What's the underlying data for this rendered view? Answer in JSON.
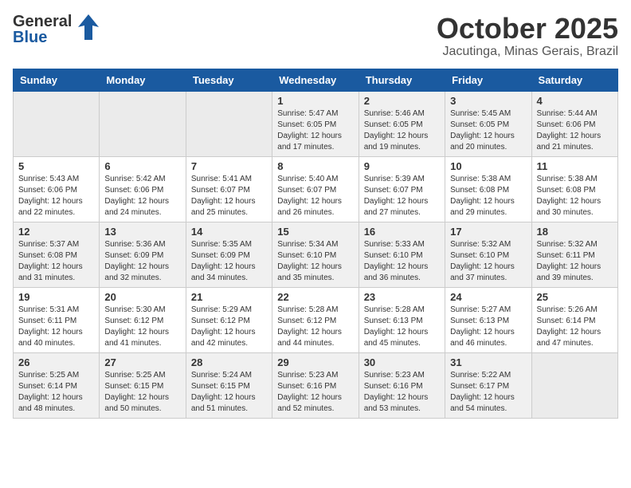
{
  "header": {
    "logo_general": "General",
    "logo_blue": "Blue",
    "month": "October 2025",
    "location": "Jacutinga, Minas Gerais, Brazil"
  },
  "weekdays": [
    "Sunday",
    "Monday",
    "Tuesday",
    "Wednesday",
    "Thursday",
    "Friday",
    "Saturday"
  ],
  "weeks": [
    [
      {
        "day": "",
        "info": ""
      },
      {
        "day": "",
        "info": ""
      },
      {
        "day": "",
        "info": ""
      },
      {
        "day": "1",
        "info": "Sunrise: 5:47 AM\nSunset: 6:05 PM\nDaylight: 12 hours\nand 17 minutes."
      },
      {
        "day": "2",
        "info": "Sunrise: 5:46 AM\nSunset: 6:05 PM\nDaylight: 12 hours\nand 19 minutes."
      },
      {
        "day": "3",
        "info": "Sunrise: 5:45 AM\nSunset: 6:05 PM\nDaylight: 12 hours\nand 20 minutes."
      },
      {
        "day": "4",
        "info": "Sunrise: 5:44 AM\nSunset: 6:06 PM\nDaylight: 12 hours\nand 21 minutes."
      }
    ],
    [
      {
        "day": "5",
        "info": "Sunrise: 5:43 AM\nSunset: 6:06 PM\nDaylight: 12 hours\nand 22 minutes."
      },
      {
        "day": "6",
        "info": "Sunrise: 5:42 AM\nSunset: 6:06 PM\nDaylight: 12 hours\nand 24 minutes."
      },
      {
        "day": "7",
        "info": "Sunrise: 5:41 AM\nSunset: 6:07 PM\nDaylight: 12 hours\nand 25 minutes."
      },
      {
        "day": "8",
        "info": "Sunrise: 5:40 AM\nSunset: 6:07 PM\nDaylight: 12 hours\nand 26 minutes."
      },
      {
        "day": "9",
        "info": "Sunrise: 5:39 AM\nSunset: 6:07 PM\nDaylight: 12 hours\nand 27 minutes."
      },
      {
        "day": "10",
        "info": "Sunrise: 5:38 AM\nSunset: 6:08 PM\nDaylight: 12 hours\nand 29 minutes."
      },
      {
        "day": "11",
        "info": "Sunrise: 5:38 AM\nSunset: 6:08 PM\nDaylight: 12 hours\nand 30 minutes."
      }
    ],
    [
      {
        "day": "12",
        "info": "Sunrise: 5:37 AM\nSunset: 6:08 PM\nDaylight: 12 hours\nand 31 minutes."
      },
      {
        "day": "13",
        "info": "Sunrise: 5:36 AM\nSunset: 6:09 PM\nDaylight: 12 hours\nand 32 minutes."
      },
      {
        "day": "14",
        "info": "Sunrise: 5:35 AM\nSunset: 6:09 PM\nDaylight: 12 hours\nand 34 minutes."
      },
      {
        "day": "15",
        "info": "Sunrise: 5:34 AM\nSunset: 6:10 PM\nDaylight: 12 hours\nand 35 minutes."
      },
      {
        "day": "16",
        "info": "Sunrise: 5:33 AM\nSunset: 6:10 PM\nDaylight: 12 hours\nand 36 minutes."
      },
      {
        "day": "17",
        "info": "Sunrise: 5:32 AM\nSunset: 6:10 PM\nDaylight: 12 hours\nand 37 minutes."
      },
      {
        "day": "18",
        "info": "Sunrise: 5:32 AM\nSunset: 6:11 PM\nDaylight: 12 hours\nand 39 minutes."
      }
    ],
    [
      {
        "day": "19",
        "info": "Sunrise: 5:31 AM\nSunset: 6:11 PM\nDaylight: 12 hours\nand 40 minutes."
      },
      {
        "day": "20",
        "info": "Sunrise: 5:30 AM\nSunset: 6:12 PM\nDaylight: 12 hours\nand 41 minutes."
      },
      {
        "day": "21",
        "info": "Sunrise: 5:29 AM\nSunset: 6:12 PM\nDaylight: 12 hours\nand 42 minutes."
      },
      {
        "day": "22",
        "info": "Sunrise: 5:28 AM\nSunset: 6:12 PM\nDaylight: 12 hours\nand 44 minutes."
      },
      {
        "day": "23",
        "info": "Sunrise: 5:28 AM\nSunset: 6:13 PM\nDaylight: 12 hours\nand 45 minutes."
      },
      {
        "day": "24",
        "info": "Sunrise: 5:27 AM\nSunset: 6:13 PM\nDaylight: 12 hours\nand 46 minutes."
      },
      {
        "day": "25",
        "info": "Sunrise: 5:26 AM\nSunset: 6:14 PM\nDaylight: 12 hours\nand 47 minutes."
      }
    ],
    [
      {
        "day": "26",
        "info": "Sunrise: 5:25 AM\nSunset: 6:14 PM\nDaylight: 12 hours\nand 48 minutes."
      },
      {
        "day": "27",
        "info": "Sunrise: 5:25 AM\nSunset: 6:15 PM\nDaylight: 12 hours\nand 50 minutes."
      },
      {
        "day": "28",
        "info": "Sunrise: 5:24 AM\nSunset: 6:15 PM\nDaylight: 12 hours\nand 51 minutes."
      },
      {
        "day": "29",
        "info": "Sunrise: 5:23 AM\nSunset: 6:16 PM\nDaylight: 12 hours\nand 52 minutes."
      },
      {
        "day": "30",
        "info": "Sunrise: 5:23 AM\nSunset: 6:16 PM\nDaylight: 12 hours\nand 53 minutes."
      },
      {
        "day": "31",
        "info": "Sunrise: 5:22 AM\nSunset: 6:17 PM\nDaylight: 12 hours\nand 54 minutes."
      },
      {
        "day": "",
        "info": ""
      }
    ]
  ]
}
